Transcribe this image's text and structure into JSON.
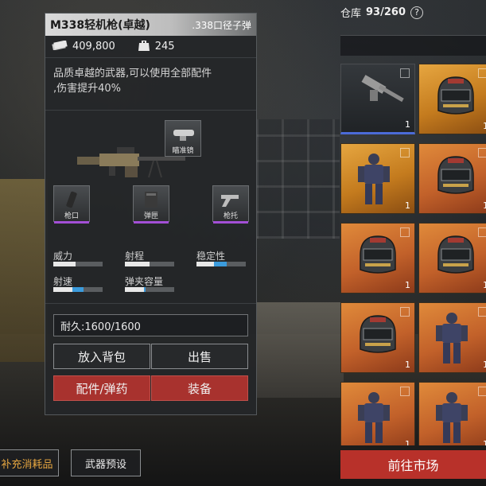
{
  "item": {
    "name": "M338轻机枪(卓越)",
    "ammo_type": ".338口径子弹",
    "price": "409,800",
    "weight": "245",
    "description_line1": "品质卓越的武器,可以使用全部配件",
    "description_line2": ",伤害提升40%"
  },
  "slots": {
    "scope": "瞄准镜",
    "muzzle": "枪口",
    "magazine": "弹匣",
    "stock": "枪托"
  },
  "stats": [
    {
      "label": "威力",
      "value": 0.45,
      "accent_from": 0,
      "accent_to": 0
    },
    {
      "label": "射程",
      "value": 0.5,
      "accent_from": 0,
      "accent_to": 0
    },
    {
      "label": "稳定性",
      "value": 0.35,
      "accent_from": 0.35,
      "accent_to": 0.62
    },
    {
      "label": "射速",
      "value": 0.45,
      "accent_from": 0.38,
      "accent_to": 0.62
    },
    {
      "label": "弹夹容量",
      "value": 0.4,
      "accent_from": 0.38,
      "accent_to": 0.42
    }
  ],
  "durability": "耐久:1600/1600",
  "buttons": {
    "backpack": "放入背包",
    "sell": "出售",
    "attachments": "配件/弹药",
    "equip": "装备"
  },
  "inventory": {
    "label": "仓库",
    "count": "93/260",
    "help": "?",
    "items": [
      {
        "kind": "gun",
        "rarity": "dark",
        "qty": "1",
        "selected": true
      },
      {
        "kind": "helmet",
        "rarity": "gold",
        "qty": "1"
      },
      {
        "kind": "armor",
        "rarity": "gold",
        "qty": "1"
      },
      {
        "kind": "helmet",
        "rarity": "orange",
        "qty": "1"
      },
      {
        "kind": "helmet",
        "rarity": "orange",
        "qty": "1"
      },
      {
        "kind": "helmet",
        "rarity": "orange",
        "qty": "1"
      },
      {
        "kind": "helmet",
        "rarity": "orange",
        "qty": "1"
      },
      {
        "kind": "armor",
        "rarity": "orange",
        "qty": "1"
      },
      {
        "kind": "armor",
        "rarity": "orange",
        "qty": "1"
      },
      {
        "kind": "armor",
        "rarity": "orange",
        "qty": "1"
      }
    ]
  },
  "market_button": "前往市场",
  "bottom": {
    "consumables": "补充消耗品",
    "weapon_preset": "武器预设"
  }
}
